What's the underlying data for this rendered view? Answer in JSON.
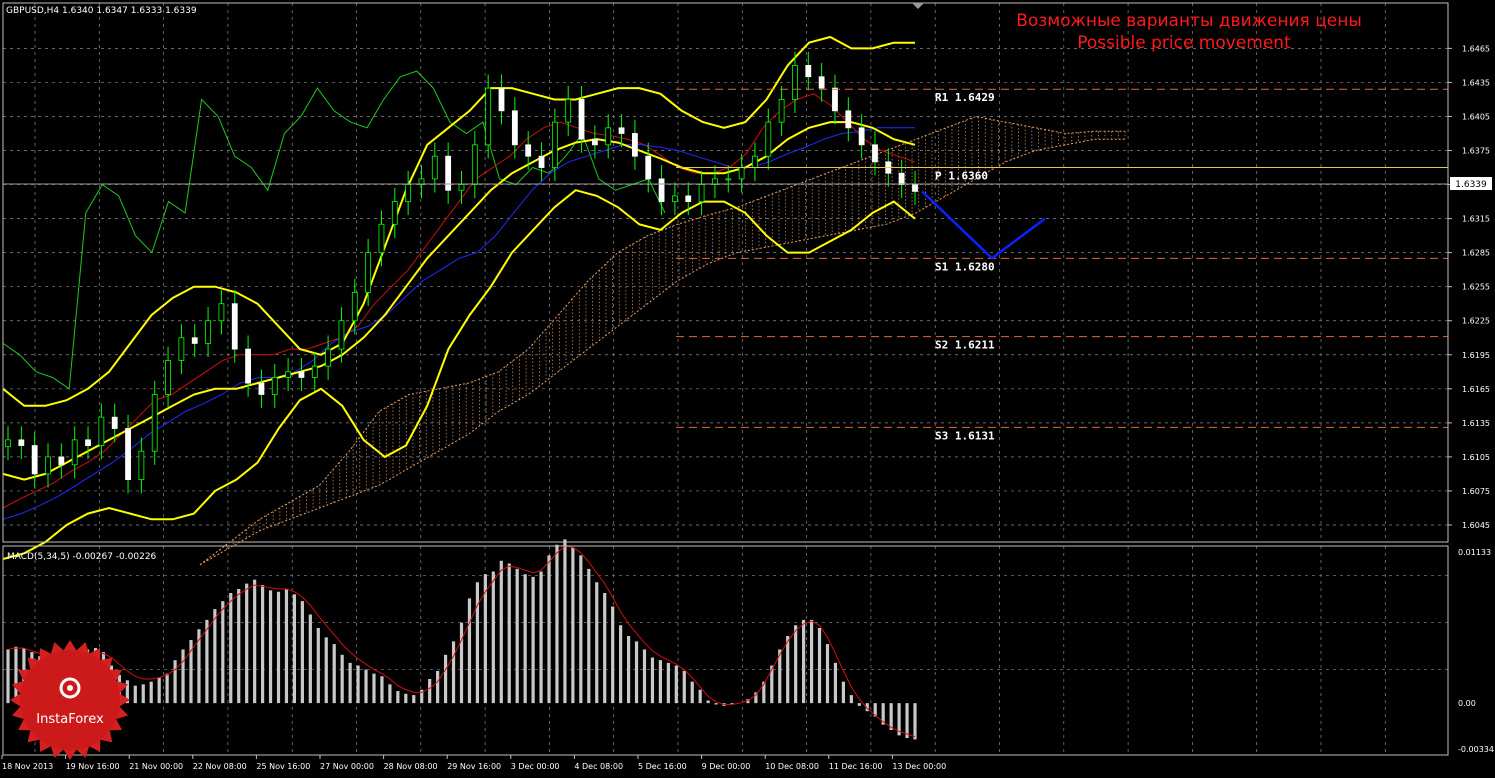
{
  "header": {
    "symbol_line": "GBPUSD,H4  1.6340 1.6347 1.6333 1.6339",
    "title_ru": "Возможные варианты движения цены",
    "title_en": "Possible price movement"
  },
  "macd_header": "MACD(5,34,5) -0.00267 -0.00226",
  "current_price_label": "1.6339",
  "logo_text": "InstaForex",
  "colors": {
    "background": "#000000",
    "grid": "#8a8a8a",
    "title": "#ff1a1a",
    "bollinger": "#ffff00",
    "ma_red": "#d01010",
    "ma_blue": "#1e2cff",
    "chikou": "#1fc81f",
    "cloud": "#e8a060",
    "candle": "#00ff00",
    "projection": "#0a22ff",
    "level_line": "#e06a3a",
    "pivot_line": "#e6c84a",
    "macd_hist": "#c8c8c8",
    "macd_signal": "#d01010"
  },
  "chart_data": [
    {
      "type": "line",
      "title": "GBPUSD,H4",
      "y_axis_ticks": [
        "1.6465",
        "1.6435",
        "1.6405",
        "1.6375",
        "1.6345",
        "1.6315",
        "1.6285",
        "1.6255",
        "1.6225",
        "1.6195",
        "1.6165",
        "1.6135",
        "1.6105",
        "1.6075",
        "1.6045"
      ],
      "x_axis_ticks": [
        "18 Nov 2013",
        "19 Nov 16:00",
        "21 Nov 00:00",
        "22 Nov 08:00",
        "25 Nov 16:00",
        "27 Nov 00:00",
        "28 Nov 08:00",
        "29 Nov 16:00",
        "3 Dec 00:00",
        "4 Dec 08:00",
        "5 Dec 16:00",
        "9 Dec 00:00",
        "10 Dec 08:00",
        "11 Dec 16:00",
        "13 Dec 00:00"
      ],
      "ylim": [
        1.603,
        1.6505
      ],
      "grid": true,
      "levels": [
        {
          "name": "R1",
          "value": 1.6429,
          "label": "R1  1.6429"
        },
        {
          "name": "P",
          "value": 1.636,
          "label": "P  1.6360"
        },
        {
          "name": "S1",
          "value": 1.628,
          "label": "S1  1.6280"
        },
        {
          "name": "S2",
          "value": 1.6211,
          "label": "S2  1.6211"
        },
        {
          "name": "S3",
          "value": 1.6131,
          "label": "S3  1.6131"
        }
      ],
      "current_price": 1.6339,
      "price_close": [
        1.612,
        1.6115,
        1.609,
        1.6105,
        1.6098,
        1.612,
        1.6115,
        1.614,
        1.613,
        1.6085,
        1.611,
        1.616,
        1.619,
        1.621,
        1.6205,
        1.6225,
        1.624,
        1.62,
        1.617,
        1.616,
        1.6175,
        1.618,
        1.6175,
        1.6185,
        1.62,
        1.6225,
        1.625,
        1.6285,
        1.631,
        1.633,
        1.6345,
        1.635,
        1.637,
        1.634,
        1.6345,
        1.638,
        1.643,
        1.641,
        1.638,
        1.637,
        1.636,
        1.64,
        1.642,
        1.6385,
        1.638,
        1.6395,
        1.639,
        1.637,
        1.635,
        1.633,
        1.6335,
        1.633,
        1.6345,
        1.635,
        1.635,
        1.636,
        1.637,
        1.64,
        1.642,
        1.645,
        1.644,
        1.643,
        1.641,
        1.6395,
        1.638,
        1.6365,
        1.6355,
        1.6345,
        1.6339
      ],
      "series": [
        {
          "name": "MA red",
          "values": [
            1.606,
            1.6068,
            1.6075,
            1.6082,
            1.6092,
            1.61,
            1.611,
            1.6125,
            1.614,
            1.6155,
            1.616,
            1.617,
            1.618,
            1.619,
            1.6195,
            1.6195,
            1.6195,
            1.62,
            1.62,
            1.6205,
            1.621,
            1.622,
            1.624,
            1.6255,
            1.627,
            1.629,
            1.631,
            1.633,
            1.635,
            1.636,
            1.637,
            1.6385,
            1.6395,
            1.64,
            1.6395,
            1.639,
            1.6388,
            1.6385,
            1.638,
            1.637,
            1.636,
            1.6355,
            1.6355,
            1.636,
            1.6372,
            1.6395,
            1.641,
            1.642,
            1.6425,
            1.6415,
            1.64,
            1.6385,
            1.6375,
            1.637,
            1.6365
          ]
        },
        {
          "name": "MA blue",
          "values": [
            1.605,
            1.6055,
            1.6062,
            1.607,
            1.608,
            1.609,
            1.61,
            1.6112,
            1.6125,
            1.6135,
            1.6145,
            1.6152,
            1.616,
            1.617,
            1.6175,
            1.6175,
            1.618,
            1.619,
            1.6205,
            1.6215,
            1.622,
            1.623,
            1.6245,
            1.626,
            1.627,
            1.628,
            1.6285,
            1.63,
            1.632,
            1.634,
            1.6355,
            1.6365,
            1.637,
            1.6375,
            1.638,
            1.638,
            1.6378,
            1.6375,
            1.637,
            1.6365,
            1.636,
            1.636,
            1.6365,
            1.6372,
            1.6378,
            1.6385,
            1.639,
            1.6392,
            1.6395,
            1.6395,
            1.6395
          ]
        },
        {
          "name": "Chikou",
          "values": [
            1.6205,
            1.6195,
            1.618,
            1.6175,
            1.6165,
            1.632,
            1.6345,
            1.6335,
            1.63,
            1.6285,
            1.633,
            1.632,
            1.642,
            1.6405,
            1.637,
            1.636,
            1.634,
            1.639,
            1.6405,
            1.643,
            1.641,
            1.64,
            1.6395,
            1.642,
            1.644,
            1.6445,
            1.643,
            1.64,
            1.639,
            1.64,
            1.635,
            1.6345,
            1.636,
            1.6355,
            1.637,
            1.639,
            1.635,
            1.634,
            1.6345,
            1.635,
            1.632
          ]
        }
      ],
      "bollinger": {
        "upper": [
          1.6165,
          1.615,
          1.615,
          1.6155,
          1.6165,
          1.618,
          1.6205,
          1.623,
          1.6245,
          1.6255,
          1.6255,
          1.625,
          1.624,
          1.622,
          1.62,
          1.6195,
          1.6205,
          1.624,
          1.629,
          1.634,
          1.638,
          1.6395,
          1.641,
          1.643,
          1.643,
          1.6425,
          1.642,
          1.642,
          1.6425,
          1.643,
          1.643,
          1.6425,
          1.641,
          1.64,
          1.6395,
          1.64,
          1.642,
          1.645,
          1.647,
          1.6475,
          1.6465,
          1.6465,
          1.647,
          1.647
        ],
        "middle": [
          1.609,
          1.6085,
          1.609,
          1.61,
          1.611,
          1.612,
          1.613,
          1.614,
          1.615,
          1.616,
          1.6165,
          1.6165,
          1.617,
          1.6175,
          1.618,
          1.6185,
          1.6195,
          1.621,
          1.623,
          1.6255,
          1.628,
          1.63,
          1.632,
          1.634,
          1.6355,
          1.6365,
          1.6375,
          1.6382,
          1.6385,
          1.6382,
          1.6375,
          1.6368,
          1.636,
          1.6355,
          1.6355,
          1.636,
          1.637,
          1.6385,
          1.6395,
          1.64,
          1.64,
          1.6395,
          1.6385,
          1.638
        ],
        "lower": [
          1.6015,
          1.602,
          1.603,
          1.6045,
          1.6055,
          1.606,
          1.6055,
          1.605,
          1.605,
          1.6055,
          1.6075,
          1.6085,
          1.61,
          1.613,
          1.6155,
          1.6165,
          1.615,
          1.612,
          1.6105,
          1.6115,
          1.615,
          1.62,
          1.623,
          1.6255,
          1.6285,
          1.6305,
          1.6325,
          1.634,
          1.6335,
          1.6325,
          1.631,
          1.6305,
          1.632,
          1.633,
          1.633,
          1.632,
          1.63,
          1.6285,
          1.6285,
          1.6295,
          1.6305,
          1.632,
          1.633,
          1.6315
        ]
      },
      "projection": [
        [
          1.6339,
          0
        ],
        [
          1.628,
          1
        ],
        [
          1.6315,
          2
        ]
      ]
    },
    {
      "type": "bar",
      "title": "MACD(5,34,5) -0.00267 -0.00226",
      "y_axis_ticks": [
        "0.01133",
        "0.00",
        "-0.00334"
      ],
      "ylim": [
        -0.00334,
        0.01133
      ],
      "values": [
        0.004,
        0.0042,
        0.0041,
        0.0038,
        0.0035,
        0.0033,
        0.0031,
        0.003,
        0.0032,
        0.0036,
        0.004,
        0.0041,
        0.0038,
        0.0028,
        0.0021,
        0.0017,
        0.0013,
        0.0014,
        0.0016,
        0.0019,
        0.0022,
        0.0032,
        0.004,
        0.0047,
        0.0055,
        0.0062,
        0.007,
        0.0076,
        0.0082,
        0.0085,
        0.0089,
        0.0092,
        0.0088,
        0.0084,
        0.0083,
        0.0085,
        0.0081,
        0.0076,
        0.0066,
        0.0056,
        0.0049,
        0.0044,
        0.0036,
        0.003,
        0.0028,
        0.0025,
        0.0022,
        0.002,
        0.0014,
        0.0009,
        0.0007,
        0.0006,
        0.001,
        0.0018,
        0.0024,
        0.0036,
        0.0046,
        0.006,
        0.0078,
        0.009,
        0.0096,
        0.0098,
        0.0106,
        0.0104,
        0.01,
        0.0096,
        0.0094,
        0.0098,
        0.011,
        0.0118,
        0.0122,
        0.0116,
        0.011,
        0.01,
        0.009,
        0.0082,
        0.0072,
        0.0058,
        0.005,
        0.0046,
        0.004,
        0.0034,
        0.0032,
        0.003,
        0.0028,
        0.0024,
        0.0016,
        0.001,
        0.0002,
        -0.0001,
        -0.0002,
        -0.0001,
        0.0,
        0.0003,
        0.0008,
        0.0016,
        0.0028,
        0.004,
        0.005,
        0.0058,
        0.0062,
        0.0062,
        0.0056,
        0.0044,
        0.003,
        0.0016,
        0.0006,
        -0.0002,
        -0.0006,
        -0.001,
        -0.0016,
        -0.002,
        -0.0024,
        -0.0026,
        -0.0027
      ],
      "signal": [
        0.004,
        0.0041,
        0.0041,
        0.0039,
        0.0037,
        0.0034,
        0.0031,
        0.0029,
        0.0029,
        0.0031,
        0.0034,
        0.0037,
        0.0037,
        0.0034,
        0.0029,
        0.0024,
        0.002,
        0.0018,
        0.0018,
        0.0019,
        0.0021,
        0.0025,
        0.0031,
        0.0039,
        0.0047,
        0.0055,
        0.0063,
        0.007,
        0.0076,
        0.0081,
        0.0085,
        0.0088,
        0.0087,
        0.0086,
        0.0085,
        0.0085,
        0.0083,
        0.0079,
        0.0073,
        0.0065,
        0.0058,
        0.0051,
        0.0044,
        0.0038,
        0.0033,
        0.0029,
        0.0025,
        0.0022,
        0.0018,
        0.0013,
        0.001,
        0.0008,
        0.0008,
        0.0011,
        0.0016,
        0.0025,
        0.0035,
        0.0047,
        0.006,
        0.0073,
        0.0083,
        0.0091,
        0.0099,
        0.0102,
        0.0101,
        0.0099,
        0.0097,
        0.0099,
        0.0105,
        0.0112,
        0.0117,
        0.0116,
        0.0112,
        0.0105,
        0.0097,
        0.0089,
        0.0079,
        0.0068,
        0.0059,
        0.0052,
        0.0045,
        0.0039,
        0.0035,
        0.0032,
        0.0029,
        0.0025,
        0.0019,
        0.0012,
        0.0005,
        0.0001,
        -0.0001,
        -0.0001,
        0.0,
        0.0002,
        0.0006,
        0.0014,
        0.0025,
        0.0036,
        0.0046,
        0.0054,
        0.0059,
        0.0061,
        0.0058,
        0.0049,
        0.0037,
        0.0024,
        0.0012,
        0.0003,
        -0.0004,
        -0.0009,
        -0.0014,
        -0.0018,
        -0.0021,
        -0.0023,
        -0.0025
      ]
    }
  ]
}
